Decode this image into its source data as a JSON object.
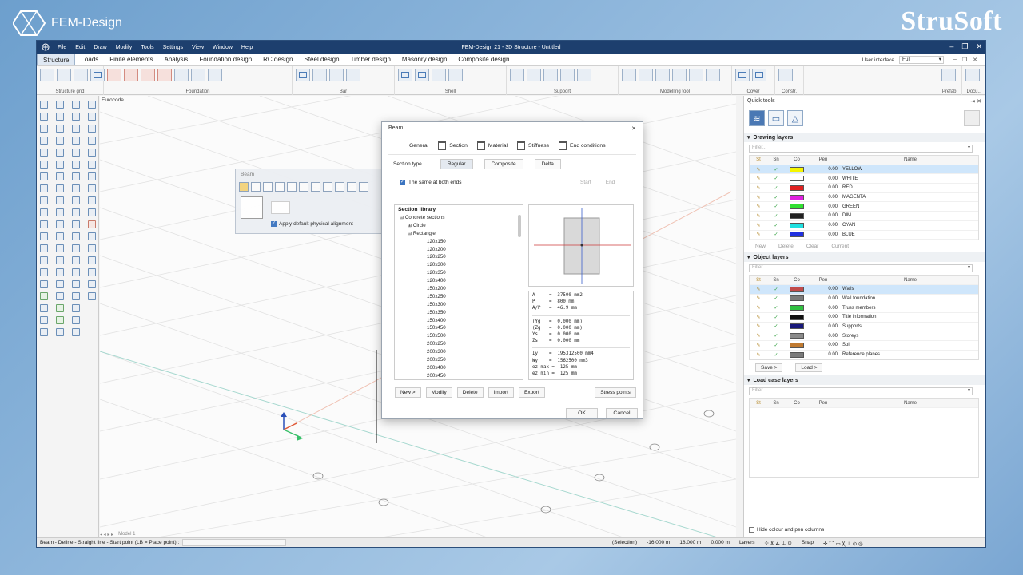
{
  "branding": {
    "left_text": "FEM-Design",
    "right_text": "StruSoft"
  },
  "window": {
    "title": "FEM-Design 21 - 3D Structure - Untitled",
    "menu": [
      "File",
      "Edit",
      "Draw",
      "Modify",
      "Tools",
      "Settings",
      "View",
      "Window",
      "Help"
    ]
  },
  "tabs": [
    "Structure",
    "Loads",
    "Finite elements",
    "Analysis",
    "Foundation design",
    "RC design",
    "Steel design",
    "Timber design",
    "Masonry design",
    "Composite design"
  ],
  "user_interface": {
    "label": "User interface",
    "value": "Full"
  },
  "ribbon_groups": [
    "Structure grid",
    "Foundation",
    "Bar",
    "Shell",
    "Support",
    "Modelling tool",
    "Cover",
    "Constr.",
    "Prefab.",
    "Docu..."
  ],
  "viewport": {
    "code_label": "Eurocode",
    "model_tab": "Model 1"
  },
  "floating_toolbar": {
    "title": "Beam",
    "option": "Apply default physical alignment"
  },
  "dialog": {
    "title": "Beam",
    "tabs": [
      "General",
      "Section",
      "Material",
      "Stiffness",
      "End conditions"
    ],
    "section_type_label": "Section type ....",
    "section_types": [
      "Regular",
      "Composite",
      "Delta"
    ],
    "same_both_ends": "The same at both ends",
    "start": "Start",
    "end": "End",
    "library_header": "Section library",
    "tree": {
      "root": "Concrete sections",
      "circle": "Circle",
      "rectangle": "Rectangle",
      "items": [
        "120x150",
        "120x200",
        "120x250",
        "120x300",
        "120x350",
        "120x400",
        "150x200",
        "150x250",
        "150x300",
        "150x350",
        "150x400",
        "150x450",
        "150x500",
        "200x250",
        "200x300",
        "200x350",
        "200x400",
        "200x450"
      ]
    },
    "properties": [
      "A     =  37500 mm2",
      "P     =  800 mm",
      "A/P   =  46.9 mm",
      "",
      "(Yg   =  0.000 mm)",
      "(Zg   =  0.000 mm)",
      "Ys    =  0.000 mm",
      "Zs    =  0.000 mm",
      "",
      "Iy    =  195312500 mm4",
      "Wy    =  1562500 mm3",
      "ez max =  125 mm",
      "ez min =  125 mm"
    ],
    "buttons": [
      "New >",
      "Modify",
      "Delete",
      "Import",
      "Export"
    ],
    "stress_points": "Stress points",
    "ok": "OK",
    "cancel": "Cancel"
  },
  "quick_tools": {
    "title": "Quick tools",
    "columns": [
      "St",
      "Sn",
      "Co",
      "Pen",
      "Name"
    ],
    "drawing_layers": {
      "title": "Drawing layers",
      "filter": "Filter...",
      "rows": [
        {
          "pen": "0.00",
          "name": "YELLOW",
          "color": "#f5f500"
        },
        {
          "pen": "0.00",
          "name": "WHITE",
          "color": "#ffffff"
        },
        {
          "pen": "0.00",
          "name": "RED",
          "color": "#e02020"
        },
        {
          "pen": "0.00",
          "name": "MAGENTA",
          "color": "#e020e0"
        },
        {
          "pen": "0.00",
          "name": "GREEN",
          "color": "#30e030"
        },
        {
          "pen": "0.00",
          "name": "DIM",
          "color": "#202020"
        },
        {
          "pen": "0.00",
          "name": "CYAN",
          "color": "#20e0e0"
        },
        {
          "pen": "0.00",
          "name": "BLUE",
          "color": "#2030e0"
        }
      ],
      "actions": [
        "New",
        "Delete",
        "Clear",
        "Current"
      ]
    },
    "object_layers": {
      "title": "Object layers",
      "filter": "Filter...",
      "rows": [
        {
          "pen": "0.00",
          "name": "Walls",
          "color": "#c04a4a"
        },
        {
          "pen": "0.00",
          "name": "Wall foundation",
          "color": "#7a7a7a"
        },
        {
          "pen": "0.00",
          "name": "Truss members",
          "color": "#30c040"
        },
        {
          "pen": "0.00",
          "name": "Title information",
          "color": "#101010"
        },
        {
          "pen": "0.00",
          "name": "Supports",
          "color": "#18187a"
        },
        {
          "pen": "0.00",
          "name": "Storeys",
          "color": "#8a8a8a"
        },
        {
          "pen": "0.00",
          "name": "Soil",
          "color": "#c07a30"
        },
        {
          "pen": "0.00",
          "name": "Reference planes",
          "color": "#7a7a7a"
        }
      ],
      "save": "Save >",
      "load": "Load >"
    },
    "load_case_layers": {
      "title": "Load case layers",
      "filter": "Filter..."
    },
    "hide_columns": "Hide colour and pen columns"
  },
  "status": {
    "prompt": "Beam - Define - Straight line - Start point (LB = Place point) :",
    "selection": "(Selection)",
    "x": "-16.000 m",
    "y": "18.000 m",
    "z": "0.000 m",
    "layers": "Layers",
    "snap": "Snap"
  }
}
